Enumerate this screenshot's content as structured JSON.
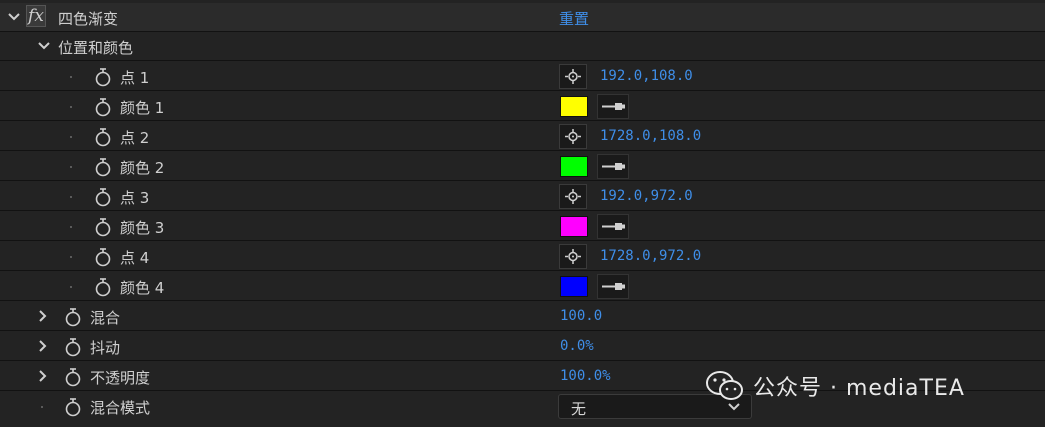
{
  "effect": {
    "title": "四色渐变",
    "reset_label": "重置",
    "fx_symbol": "fx"
  },
  "group": {
    "label": "位置和颜色"
  },
  "points": [
    {
      "point_label": "点 1",
      "coords": "192.0,108.0",
      "color_label": "颜色 1",
      "color": "#ffff00"
    },
    {
      "point_label": "点 2",
      "coords": "1728.0,108.0",
      "color_label": "颜色 2",
      "color": "#00ff00"
    },
    {
      "point_label": "点 3",
      "coords": "192.0,972.0",
      "color_label": "颜色 3",
      "color": "#ff00ff"
    },
    {
      "point_label": "点 4",
      "coords": "1728.0,972.0",
      "color_label": "颜色 4",
      "color": "#0000ff"
    }
  ],
  "params": [
    {
      "label": "混合",
      "value": "100.0"
    },
    {
      "label": "抖动",
      "value": "0.0%"
    },
    {
      "label": "不透明度",
      "value": "100.0%"
    }
  ],
  "blend_mode": {
    "label": "混合模式",
    "selected": "无"
  },
  "watermark": {
    "text": "公众号 · mediaTEA",
    "icon": "wechat-icon"
  },
  "colors": {
    "accent_value": "#3f8ee8",
    "background": "#232323"
  }
}
